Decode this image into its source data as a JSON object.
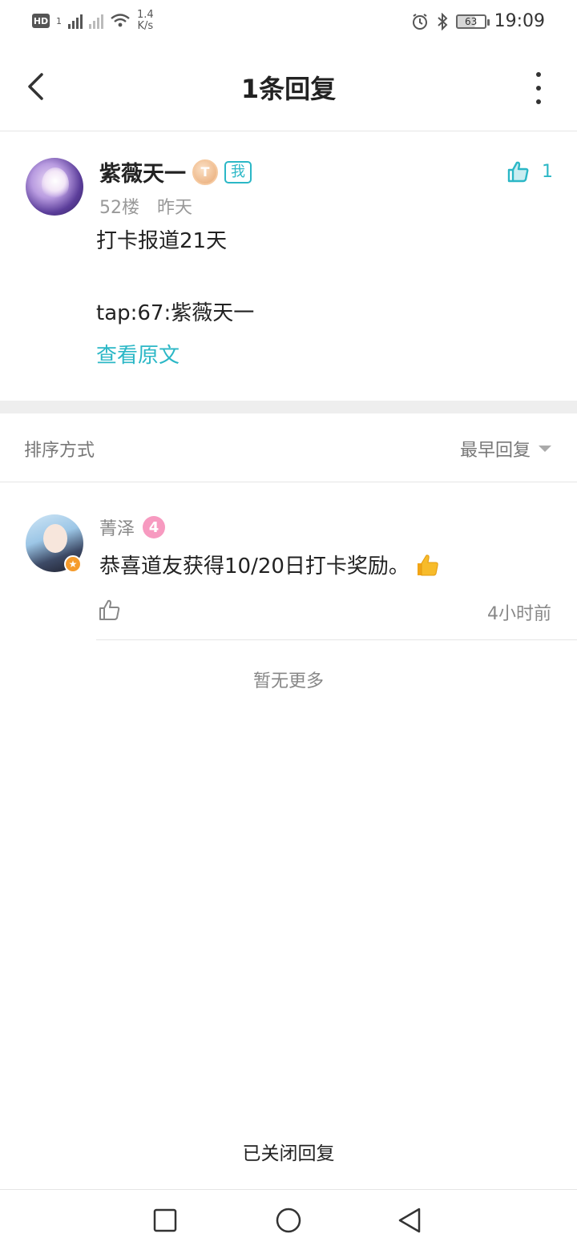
{
  "status_bar": {
    "net_speed_value": "1.4",
    "net_speed_unit": "K/s",
    "battery": "63",
    "time": "19:09"
  },
  "header": {
    "title": "1条回复"
  },
  "post": {
    "username": "紫薇天一",
    "level_badge": "T",
    "me_tag": "我",
    "like_count": "1",
    "floor": "52楼",
    "time": "昨天",
    "content": "打卡报道21天\n\ntap:67:紫薇天一",
    "view_original": "查看原文"
  },
  "sort": {
    "label": "排序方式",
    "selected": "最早回复"
  },
  "replies": [
    {
      "username": "菁泽",
      "level": "4",
      "text": "恭喜道友获得10/20日打卡奖励。",
      "time": "4小时前"
    }
  ],
  "footer": {
    "no_more": "暂无更多",
    "closed": "已关闭回复"
  },
  "colors": {
    "accent": "#2bb7c6",
    "text_primary": "#222222",
    "text_secondary": "#888888"
  },
  "icons": {
    "back": "chevron-left-icon",
    "more": "more-vertical-icon",
    "like": "thumbs-up-icon",
    "sort_caret": "caret-down-icon"
  }
}
